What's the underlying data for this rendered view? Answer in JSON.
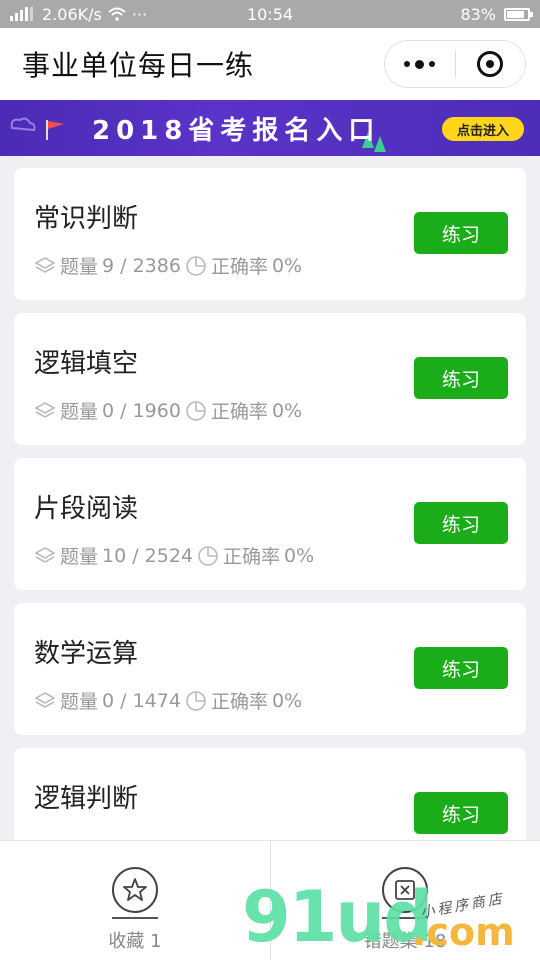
{
  "status_bar": {
    "signal_text": "ℹ︎ıll",
    "speed": "2.06K/s",
    "more": "···",
    "time": "10:54",
    "battery_percent": "83%",
    "battery_level": 0.83
  },
  "header": {
    "title": "事业单位每日一练"
  },
  "banner": {
    "text": "2018省考报名入口",
    "button_label": "点击进入"
  },
  "cards": [
    {
      "title": "常识判断",
      "count_label": "题量",
      "count": "9 / 2386",
      "accuracy_label": "正确率",
      "accuracy": "0%",
      "button": "练习"
    },
    {
      "title": "逻辑填空",
      "count_label": "题量",
      "count": "0 / 1960",
      "accuracy_label": "正确率",
      "accuracy": "0%",
      "button": "练习"
    },
    {
      "title": "片段阅读",
      "count_label": "题量",
      "count": "10 / 2524",
      "accuracy_label": "正确率",
      "accuracy": "0%",
      "button": "练习"
    },
    {
      "title": "数学运算",
      "count_label": "题量",
      "count": "0 / 1474",
      "accuracy_label": "正确率",
      "accuracy": "0%",
      "button": "练习"
    },
    {
      "title": "逻辑判断",
      "count_label": "题量",
      "count": "",
      "accuracy_label": "",
      "accuracy": "",
      "button": "练习"
    }
  ],
  "tab_bar": {
    "favorites_label": "收藏 1",
    "wrong_label": "错题集 18"
  },
  "watermark": {
    "brand": "91ud",
    "suffix": ".com",
    "tagline": "小程序商店"
  },
  "colors": {
    "primary_green": "#1aad19",
    "banner_purple": "#4b2bb5",
    "banner_button": "#ffd61a"
  }
}
